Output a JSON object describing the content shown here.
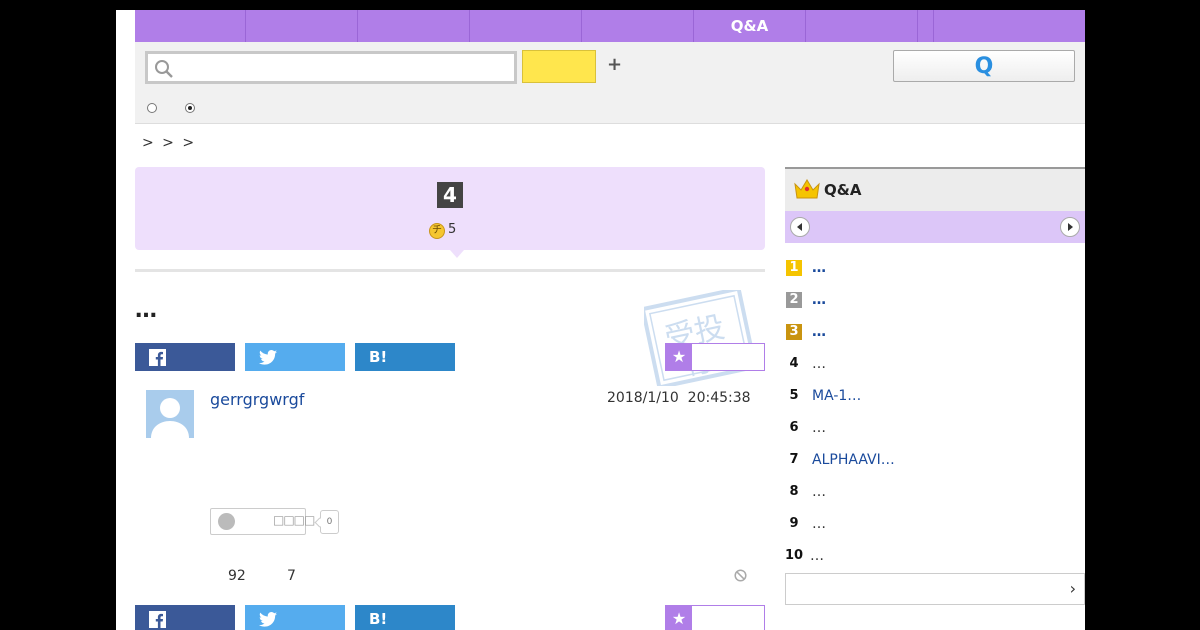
{
  "nav": {
    "items": [
      "",
      "",
      "",
      "",
      "",
      "Q&A",
      "",
      "",
      ""
    ]
  },
  "search": {
    "placeholder": "",
    "value": "",
    "plus_label": "+",
    "ask_button_glyph": "Q"
  },
  "breadcrumb": "> > >",
  "question": {
    "answer_count": "4",
    "coin_icon_glyph": "チ",
    "coin_value": "5",
    "title": "…"
  },
  "share": {
    "twitter_glyph": "",
    "hatena_label": "B!",
    "favorite_star": "★"
  },
  "post": {
    "username": "gerrgrgwrgf",
    "date": "2018/1/10  20:45:38",
    "reaction_label": "□□□□",
    "reaction_count": "0",
    "stat_views": "92",
    "stat_other": "7"
  },
  "sidebar": {
    "title": "Q&A",
    "ranking": [
      {
        "rank": "1",
        "text": "…"
      },
      {
        "rank": "2",
        "text": "…"
      },
      {
        "rank": "3",
        "text": "…"
      },
      {
        "rank": "4",
        "text": "…"
      },
      {
        "rank": "5",
        "text": "MA-1…"
      },
      {
        "rank": "6",
        "text": "…"
      },
      {
        "rank": "7",
        "text": "ALPHAAVI…"
      },
      {
        "rank": "8",
        "text": "…"
      },
      {
        "rank": "9",
        "text": "…"
      },
      {
        "rank": "10",
        "text": "…"
      }
    ],
    "more_chevron": "›"
  },
  "colors": {
    "nav_purple": "#b07ee8",
    "question_bg": "#eedffc",
    "search_yellow": "#ffe64d",
    "facebook": "#3b5998",
    "twitter": "#55acee",
    "hatena": "#2d87c9",
    "link_blue": "#1a4a9c"
  },
  "icons": {
    "search": "search-icon",
    "crown": "crown-icon",
    "stamp": "stamp-icon",
    "report": "report-icon"
  }
}
